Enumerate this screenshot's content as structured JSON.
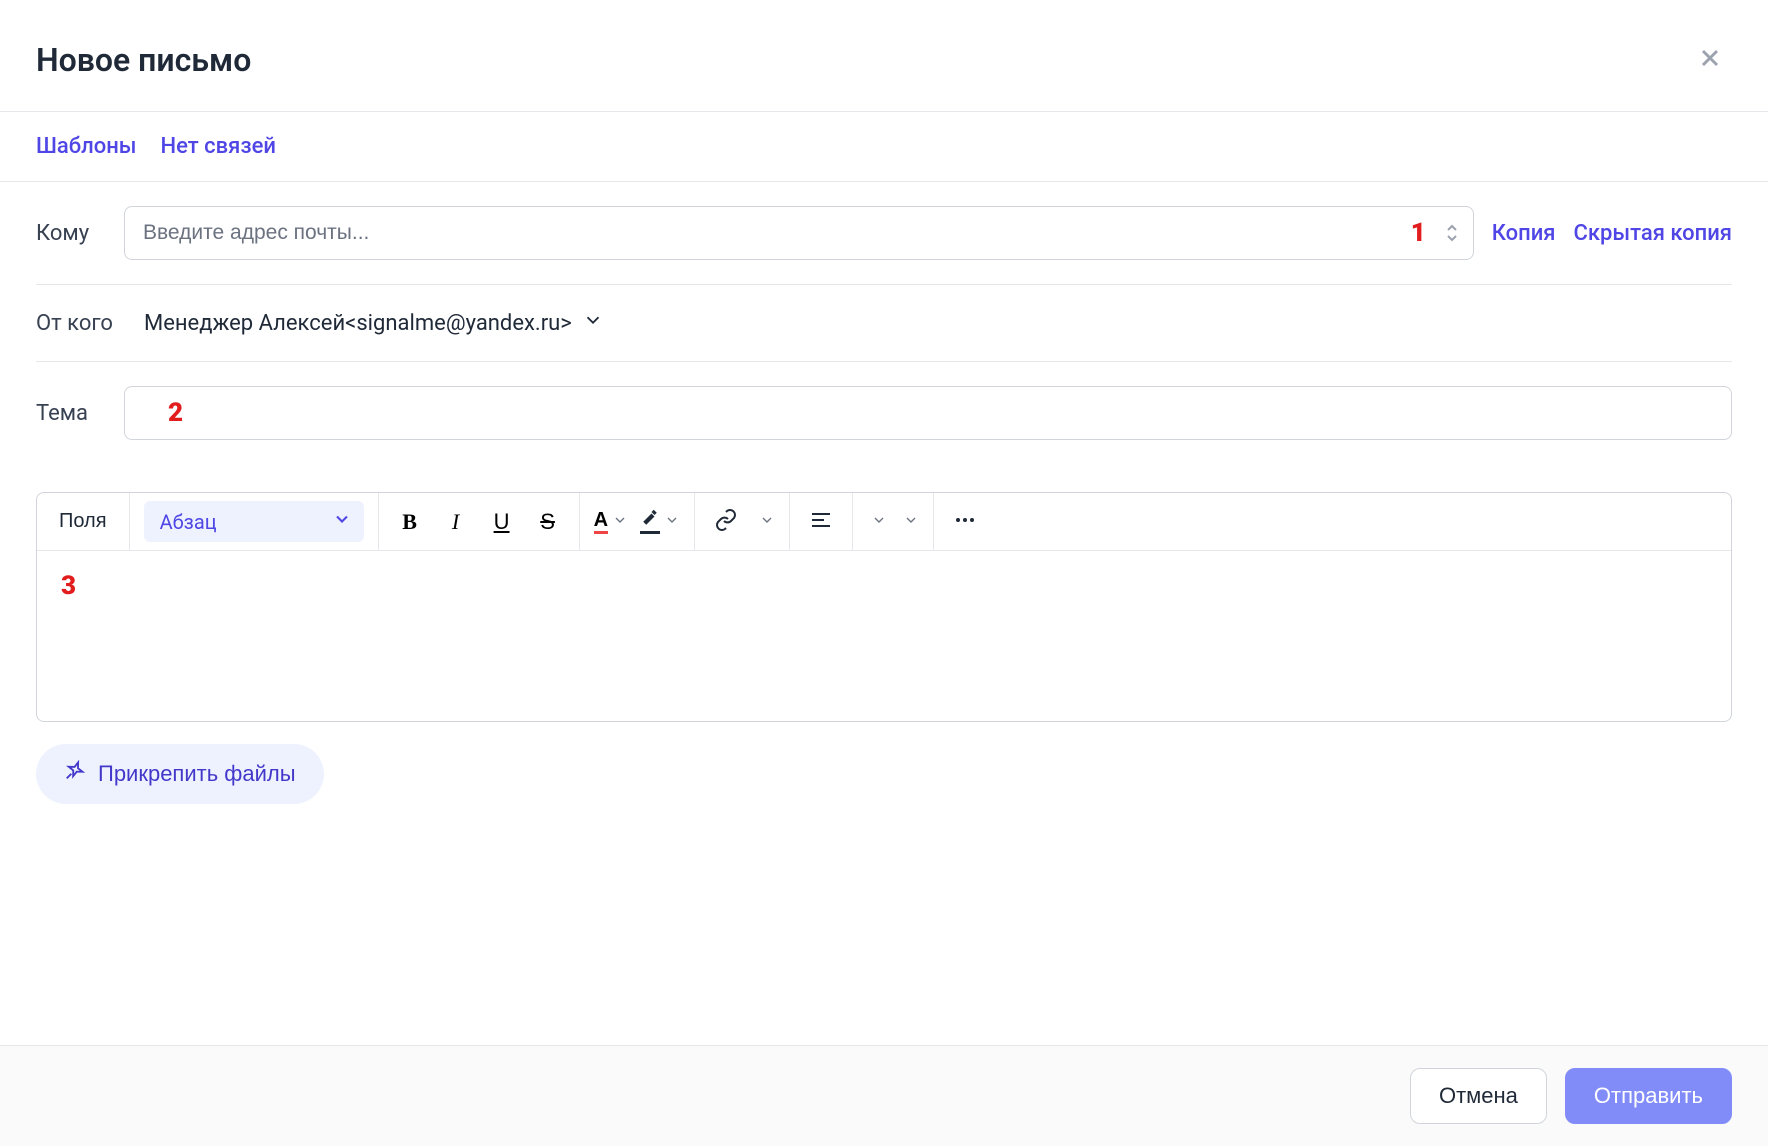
{
  "header": {
    "title": "Новое письмо"
  },
  "subheader": {
    "templates": "Шаблоны",
    "no_links": "Нет связей"
  },
  "to": {
    "label": "Кому",
    "placeholder": "Введите адрес почты...",
    "marker": "1",
    "cc": "Копия",
    "bcc": "Скрытая копия"
  },
  "from": {
    "label": "От кого",
    "value": "Менеджер Алексей<signalme@yandex.ru>"
  },
  "subject": {
    "label": "Тема",
    "marker": "2"
  },
  "toolbar": {
    "fields": "Поля",
    "format": "Абзац"
  },
  "body": {
    "marker": "3"
  },
  "attach": {
    "label": "Прикрепить файлы"
  },
  "footer": {
    "cancel": "Отмена",
    "send": "Отправить"
  }
}
